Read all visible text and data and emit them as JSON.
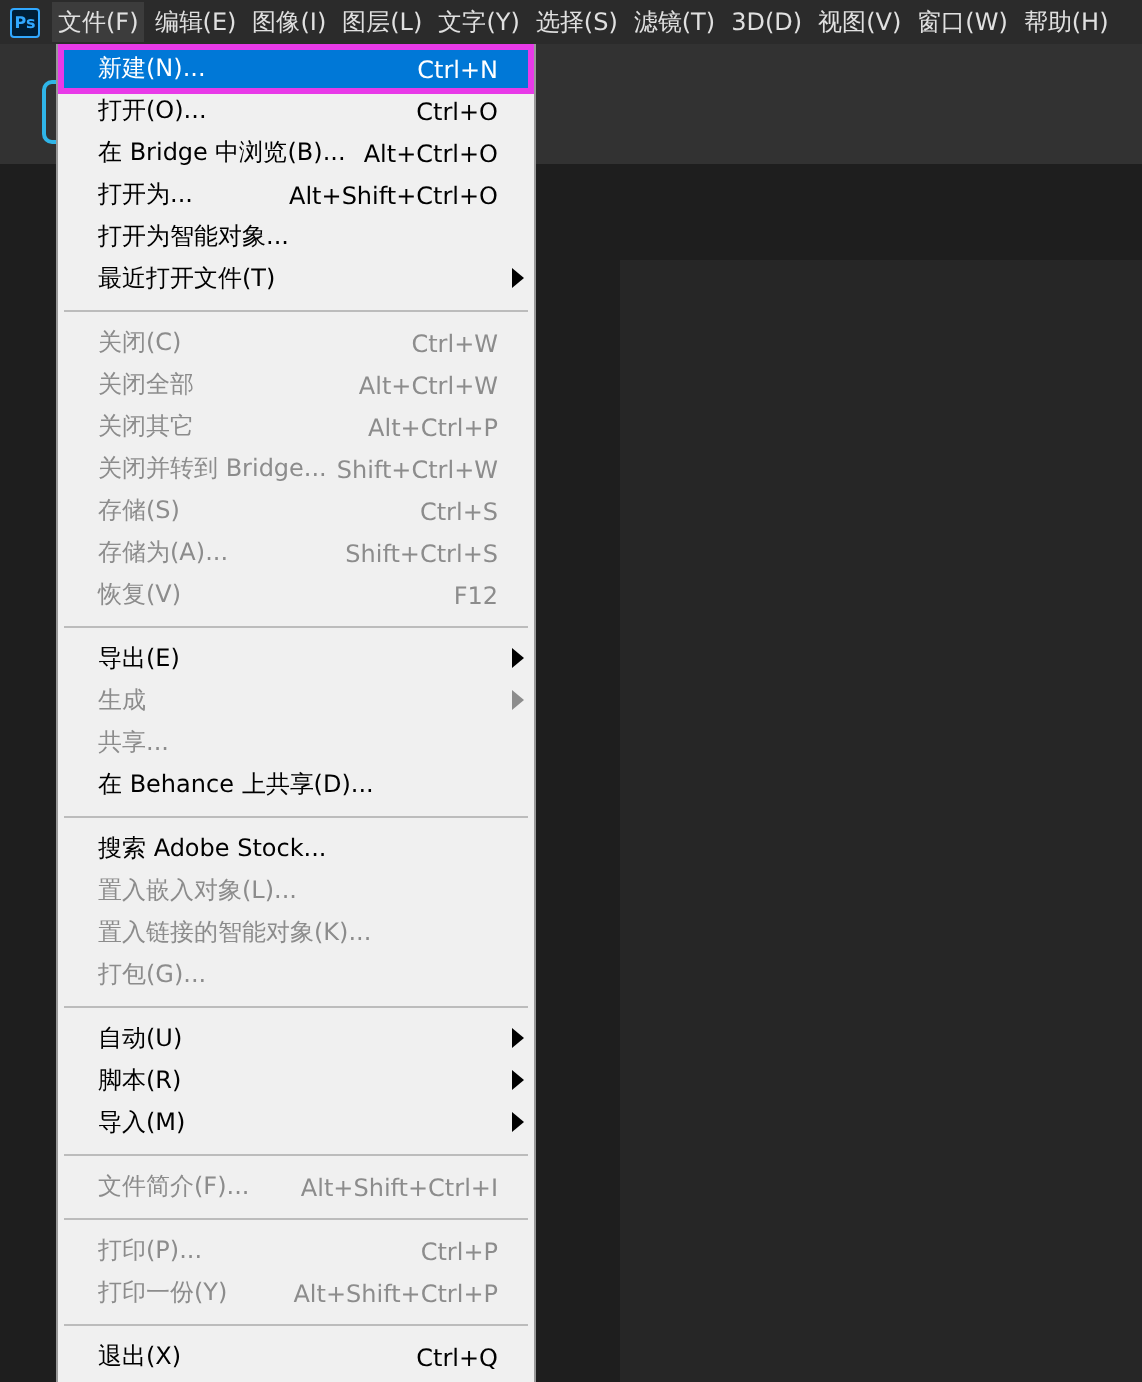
{
  "app_logo": {
    "text": "Ps"
  },
  "menubar": [
    {
      "label": "文件(F)",
      "selected": true
    },
    {
      "label": "编辑(E)",
      "selected": false
    },
    {
      "label": "图像(I)",
      "selected": false
    },
    {
      "label": "图层(L)",
      "selected": false
    },
    {
      "label": "文字(Y)",
      "selected": false
    },
    {
      "label": "选择(S)",
      "selected": false
    },
    {
      "label": "滤镜(T)",
      "selected": false
    },
    {
      "label": "3D(D)",
      "selected": false
    },
    {
      "label": "视图(V)",
      "selected": false
    },
    {
      "label": "窗口(W)",
      "selected": false
    },
    {
      "label": "帮助(H)",
      "selected": false
    }
  ],
  "file_menu": [
    [
      {
        "label": "新建(N)...",
        "shortcut": "Ctrl+N",
        "disabled": false,
        "submenu": false,
        "selected": true
      },
      {
        "label": "打开(O)...",
        "shortcut": "Ctrl+O",
        "disabled": false,
        "submenu": false,
        "selected": false
      },
      {
        "label": "在 Bridge 中浏览(B)...",
        "shortcut": "Alt+Ctrl+O",
        "disabled": false,
        "submenu": false,
        "selected": false
      },
      {
        "label": "打开为...",
        "shortcut": "Alt+Shift+Ctrl+O",
        "disabled": false,
        "submenu": false,
        "selected": false
      },
      {
        "label": "打开为智能对象...",
        "disabled": false,
        "submenu": false,
        "selected": false
      },
      {
        "label": "最近打开文件(T)",
        "disabled": false,
        "submenu": true,
        "selected": false
      }
    ],
    [
      {
        "label": "关闭(C)",
        "shortcut": "Ctrl+W",
        "disabled": true,
        "submenu": false,
        "selected": false
      },
      {
        "label": "关闭全部",
        "shortcut": "Alt+Ctrl+W",
        "disabled": true,
        "submenu": false,
        "selected": false
      },
      {
        "label": "关闭其它",
        "shortcut": "Alt+Ctrl+P",
        "disabled": true,
        "submenu": false,
        "selected": false
      },
      {
        "label": "关闭并转到 Bridge...",
        "shortcut": "Shift+Ctrl+W",
        "disabled": true,
        "submenu": false,
        "selected": false
      },
      {
        "label": "存储(S)",
        "shortcut": "Ctrl+S",
        "disabled": true,
        "submenu": false,
        "selected": false
      },
      {
        "label": "存储为(A)...",
        "shortcut": "Shift+Ctrl+S",
        "disabled": true,
        "submenu": false,
        "selected": false
      },
      {
        "label": "恢复(V)",
        "shortcut": "F12",
        "disabled": true,
        "submenu": false,
        "selected": false
      }
    ],
    [
      {
        "label": "导出(E)",
        "disabled": false,
        "submenu": true,
        "selected": false
      },
      {
        "label": "生成",
        "disabled": true,
        "submenu": true,
        "selected": false
      },
      {
        "label": "共享...",
        "disabled": true,
        "submenu": false,
        "selected": false
      },
      {
        "label": "在 Behance 上共享(D)...",
        "disabled": false,
        "submenu": false,
        "selected": false
      }
    ],
    [
      {
        "label": "搜索 Adobe Stock...",
        "disabled": false,
        "submenu": false,
        "selected": false
      },
      {
        "label": "置入嵌入对象(L)...",
        "disabled": true,
        "submenu": false,
        "selected": false
      },
      {
        "label": "置入链接的智能对象(K)...",
        "disabled": true,
        "submenu": false,
        "selected": false
      },
      {
        "label": "打包(G)...",
        "disabled": true,
        "submenu": false,
        "selected": false
      }
    ],
    [
      {
        "label": "自动(U)",
        "disabled": false,
        "submenu": true,
        "selected": false
      },
      {
        "label": "脚本(R)",
        "disabled": false,
        "submenu": true,
        "selected": false
      },
      {
        "label": "导入(M)",
        "disabled": false,
        "submenu": true,
        "selected": false
      }
    ],
    [
      {
        "label": "文件简介(F)...",
        "shortcut": "Alt+Shift+Ctrl+I",
        "disabled": true,
        "submenu": false,
        "selected": false
      }
    ],
    [
      {
        "label": "打印(P)...",
        "shortcut": "Ctrl+P",
        "disabled": true,
        "submenu": false,
        "selected": false
      },
      {
        "label": "打印一份(Y)",
        "shortcut": "Alt+Shift+Ctrl+P",
        "disabled": true,
        "submenu": false,
        "selected": false
      }
    ],
    [
      {
        "label": "退出(X)",
        "shortcut": "Ctrl+Q",
        "disabled": false,
        "submenu": false,
        "selected": false
      }
    ]
  ]
}
